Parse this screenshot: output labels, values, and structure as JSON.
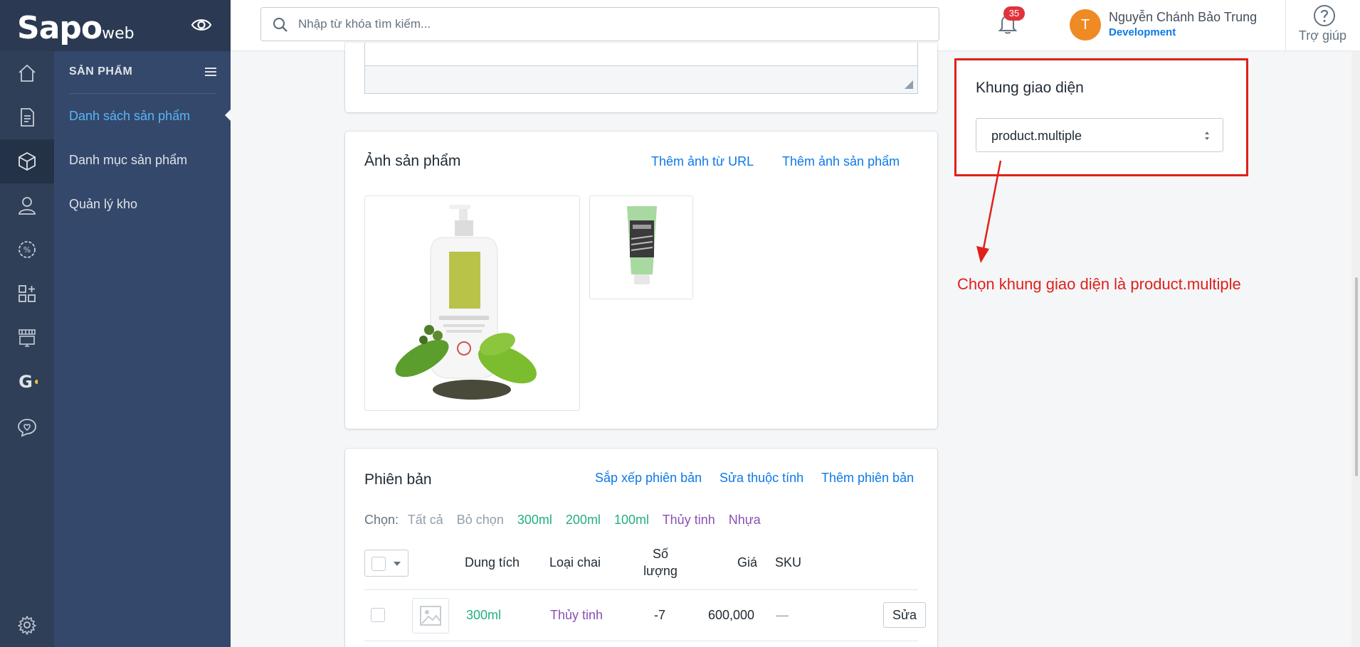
{
  "app": {
    "logo_main": "Sapo",
    "logo_sub": "web"
  },
  "colors": {
    "sidebar": "#2f3f58",
    "subnav": "#34486b",
    "link": "#0d79e8",
    "annotation": "#e0201a",
    "avatar": "#f08a24"
  },
  "rail": {
    "icons": [
      "home-icon",
      "orders-icon",
      "products-icon",
      "customers-icon",
      "promotions-icon",
      "apps-icon",
      "store-icon",
      "google-icon",
      "chat-icon",
      "settings-icon"
    ]
  },
  "subnav": {
    "title": "SẢN PHẨM",
    "items": [
      {
        "label": "Danh sách sản phẩm",
        "active": true
      },
      {
        "label": "Danh mục sản phẩm",
        "active": false
      },
      {
        "label": "Quản lý kho",
        "active": false
      }
    ]
  },
  "topbar": {
    "search_placeholder": "Nhập từ khóa tìm kiếm...",
    "notification_count": "35",
    "avatar_letter": "T",
    "user_name": "Nguyễn Chánh Bảo Trung",
    "user_role": "Development",
    "help_label": "Trợ giúp"
  },
  "images_card": {
    "title": "Ảnh sản phẩm",
    "add_url_label": "Thêm ảnh từ URL",
    "add_image_label": "Thêm ảnh sản phẩm"
  },
  "variants_card": {
    "title": "Phiên bản",
    "sort_label": "Sắp xếp phiên bản",
    "edit_attr_label": "Sửa thuộc tính",
    "add_variant_label": "Thêm phiên bản",
    "select_label": "Chọn:",
    "select_all": "Tất cả",
    "deselect": "Bỏ chọn",
    "filters": [
      {
        "label": "300ml",
        "type": "capacity"
      },
      {
        "label": "200ml",
        "type": "capacity"
      },
      {
        "label": "100ml",
        "type": "capacity"
      },
      {
        "label": "Thủy tinh",
        "type": "bottle"
      },
      {
        "label": "Nhựa",
        "type": "bottle"
      }
    ],
    "columns": {
      "capacity": "Dung tích",
      "bottle": "Loại chai",
      "quantity_line1": "Số",
      "quantity_line2": "lượng",
      "price": "Giá",
      "sku": "SKU"
    },
    "rows": [
      {
        "capacity": "300ml",
        "bottle": "Thủy tinh",
        "quantity": "-7",
        "price": "600,000",
        "sku": "—",
        "edit_label": "Sửa"
      }
    ]
  },
  "template_card": {
    "title": "Khung giao diện",
    "selected_value": "product.multiple"
  },
  "annotation": {
    "text": "Chọn khung giao diện là product.multiple"
  }
}
